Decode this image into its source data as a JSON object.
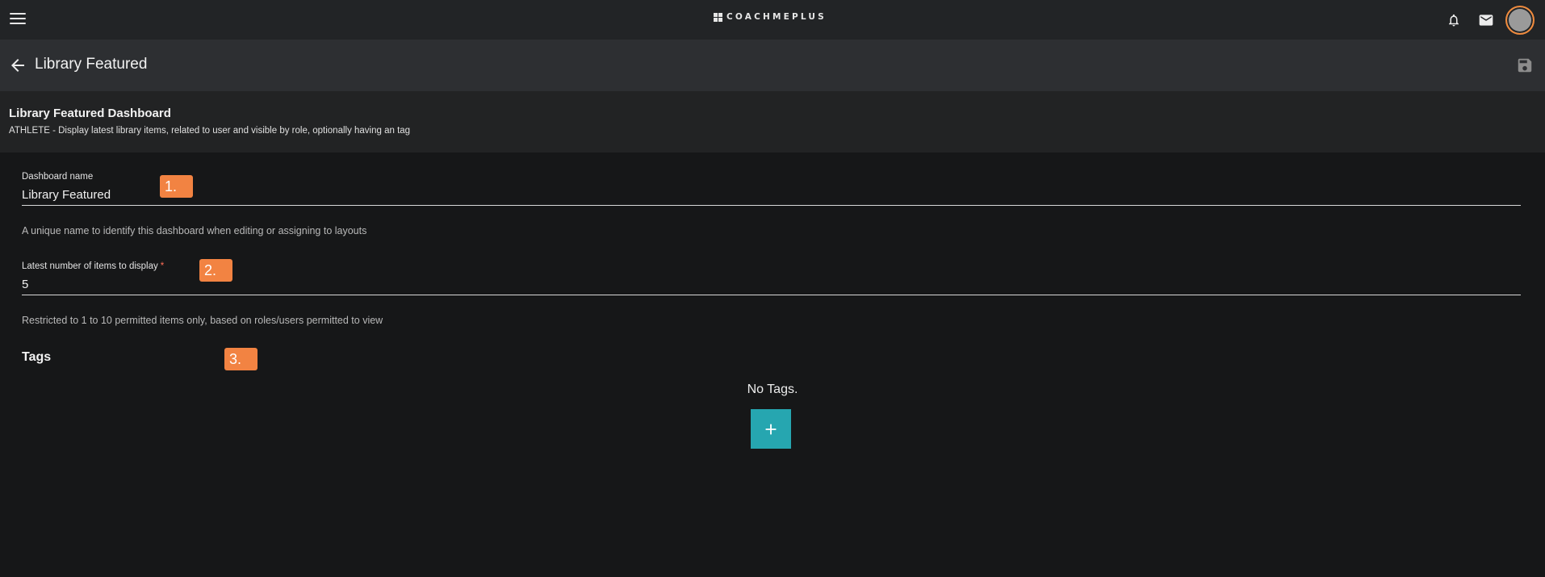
{
  "topbar": {
    "logo_text": "COACHMEPLUS",
    "menu_icon": "hamburger-menu-icon",
    "notification_icon": "bell-icon",
    "mail_icon": "envelope-icon"
  },
  "subheader": {
    "title": "Library Featured",
    "back_icon": "arrow-left-icon",
    "save_icon": "floppy-disk-icon"
  },
  "description": {
    "title": "Library Featured Dashboard",
    "text": "ATHLETE - Display latest library items, related to user and visible by role, optionally having an tag"
  },
  "form": {
    "dashboard_name": {
      "label": "Dashboard name",
      "value": "Library Featured",
      "hint": "A unique name to identify this dashboard when editing or assigning to layouts"
    },
    "item_count": {
      "label": "Latest number of items to display",
      "required_mark": "*",
      "value": "5",
      "hint": "Restricted to 1 to 10 permitted items only, based on roles/users permitted to view"
    }
  },
  "tags": {
    "title": "Tags",
    "empty_text": "No Tags.",
    "add_icon": "plus-icon"
  },
  "annotations": [
    "1.",
    "2.",
    "3."
  ],
  "colors": {
    "accent": "#26a6b0",
    "badge": "#f28342",
    "avatar_ring": "#f08a3c",
    "background": "#161718"
  }
}
